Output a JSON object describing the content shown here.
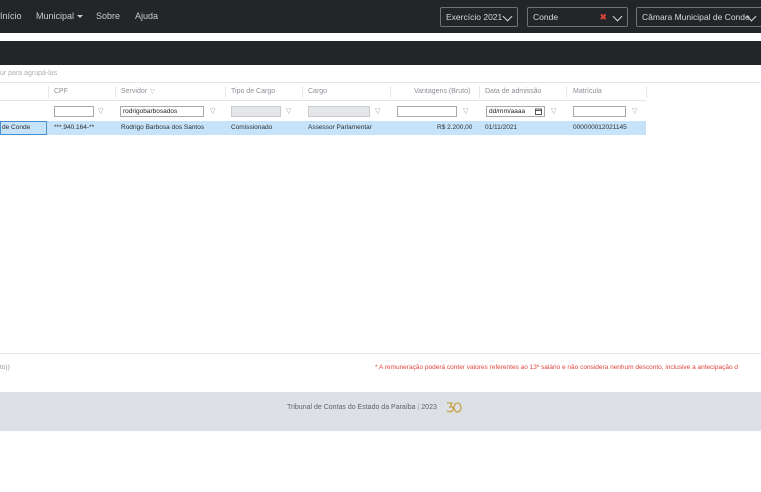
{
  "nav": {
    "home": "Início",
    "municipal": "Municipal",
    "sobre": "Sobre",
    "ajuda": "Ajuda"
  },
  "filters": {
    "year_label": "Exercício",
    "year_value": "2021",
    "city_value": "Conde",
    "org_value": "Câmara Municipal de Conde"
  },
  "grid": {
    "group_hint": "ur para agrupá-las",
    "columns": [
      "CPF",
      "Servidor",
      "Tipo de Cargo",
      "Cargo",
      "Vantagens (Bruto)",
      "Data de admissão",
      "Matrícula"
    ],
    "filters": {
      "servidor": "rodrigobarbosados",
      "data": "dd/mm/aaaa"
    },
    "row": {
      "orgao": "de Conde",
      "cpf": "***.940.164-**",
      "servidor": "Rodrigo Barbosa dos Santos",
      "tipo": "Comissionado",
      "cargo": "Assessor Parlamentar",
      "vantagens": "R$ 2.200,00",
      "data": "01/11/2021",
      "matricula": "000000012021145"
    }
  },
  "notes": {
    "left": "to))",
    "right": "* A remuneração poderá conter valores referentes ao 13º salário e não considera nenhum desconto, inclusive a antecipação d"
  },
  "footer": {
    "org": "Tribunal de Contas do Estado da Paraíba",
    "year": "2023"
  },
  "colors": {
    "nav_bg": "#222629",
    "row_highlight": "#c6e3f9",
    "note_red": "#e0443c",
    "footer_bg": "#dde1e5"
  },
  "icons": [
    "chevron-down-icon",
    "clear-icon",
    "funnel-icon",
    "calendar-icon",
    "tce-50-logo"
  ]
}
